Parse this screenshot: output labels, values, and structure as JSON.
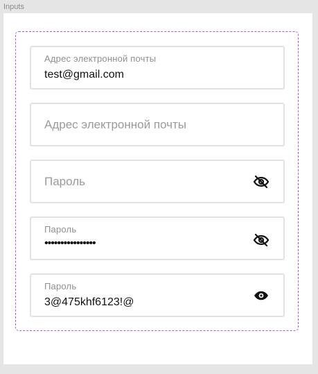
{
  "frame": {
    "title": "Inputs"
  },
  "fields": [
    {
      "label": "Адрес электронной почты",
      "value": "test@gmail.com"
    },
    {
      "placeholder": "Адрес электронной почты"
    },
    {
      "placeholder": "Пароль",
      "icon": "eye-off-icon"
    },
    {
      "label": "Пароль",
      "value": "••••••••••••••••",
      "icon": "eye-off-icon"
    },
    {
      "label": "Пароль",
      "value": "3@475khf6123!@",
      "icon": "eye-icon"
    }
  ],
  "colors": {
    "component_border": "#a35cf0",
    "field_border": "#e2e2e2",
    "label": "#8f8f8f",
    "value": "#111111"
  }
}
